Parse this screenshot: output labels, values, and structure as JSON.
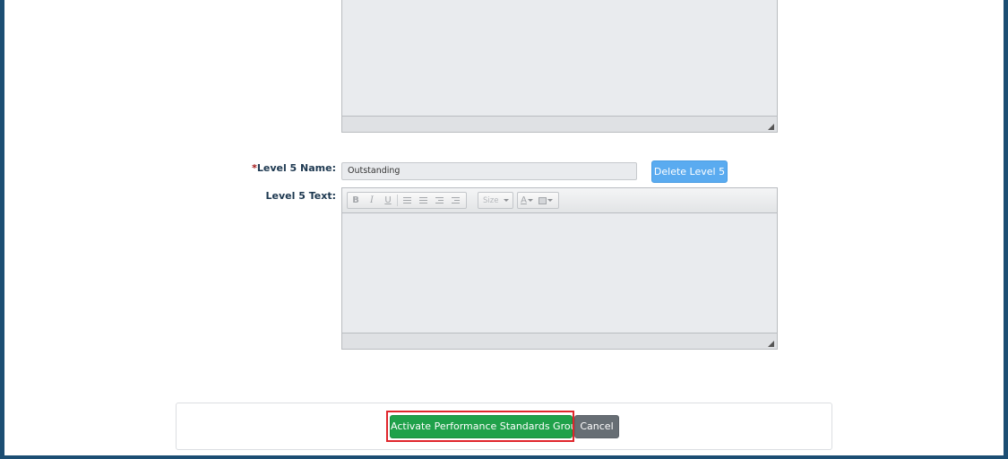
{
  "level5": {
    "name_label_required_mark": "*",
    "name_label": "Level 5 Name:",
    "name_value": "Outstanding",
    "delete_button": "Delete Level 5",
    "text_label": "Level 5 Text:"
  },
  "toolbar": {
    "bold": "B",
    "italic": "I",
    "underline": "U",
    "size_placeholder": "Size",
    "font_color": "A",
    "icons": [
      "bold-icon",
      "italic-icon",
      "underline-icon",
      "ordered-list-icon",
      "unordered-list-icon",
      "outdent-icon",
      "indent-icon",
      "font-color-icon",
      "background-color-icon"
    ]
  },
  "footer": {
    "activate_button": "Activate Performance Standards Group",
    "cancel_button": "Cancel"
  },
  "colors": {
    "frame": "#1c4e73",
    "primary_button": "#1fa14a",
    "info_button": "#5aabf0",
    "secondary_button": "#676e74",
    "highlight": "#e0262c"
  }
}
